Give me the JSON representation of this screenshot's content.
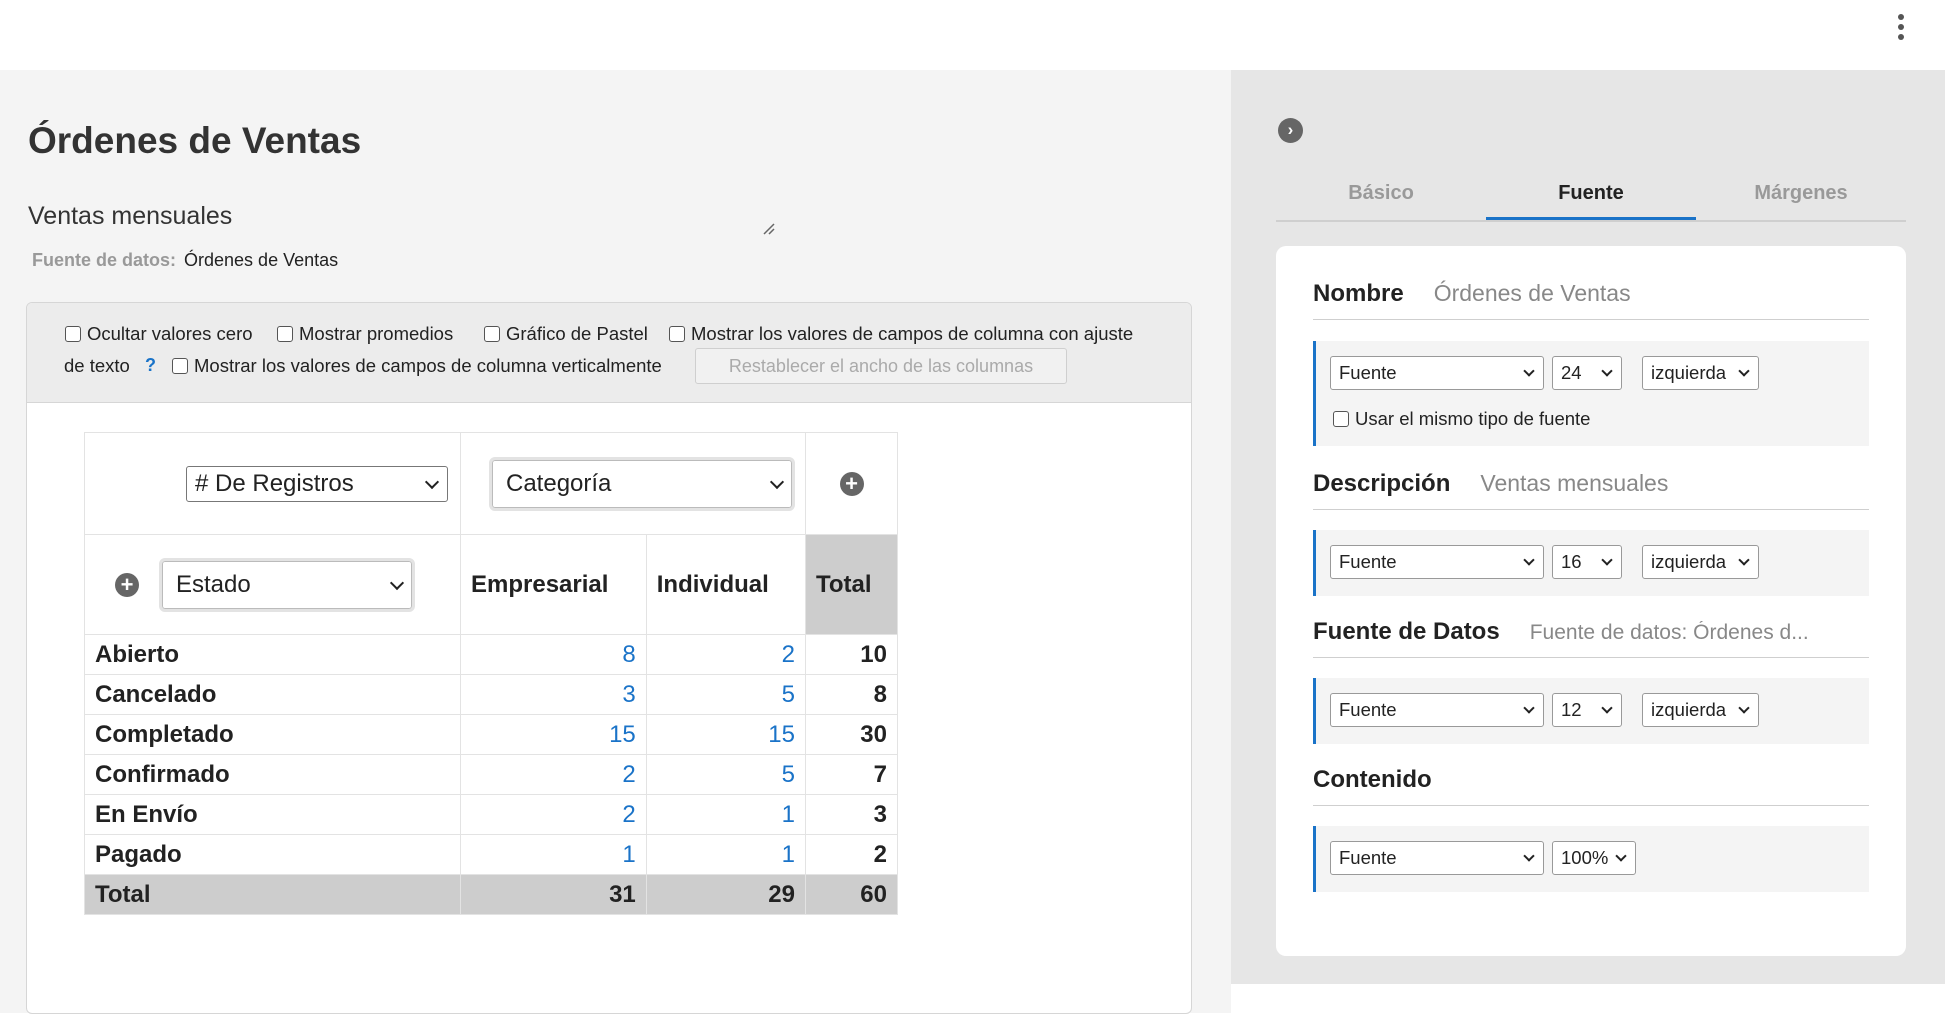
{
  "page": {
    "title": "Órdenes de Ventas",
    "description": "Ventas mensuales",
    "datasource_label": "Fuente de datos:",
    "datasource_value": "Órdenes de Ventas"
  },
  "options": {
    "hide_zero": "Ocultar valores cero",
    "show_avg": "Mostrar promedios",
    "pie": "Gráfico de Pastel",
    "wrap_part1": "Mostrar los valores de campos de columna con ajuste",
    "wrap_part2": "de texto",
    "help": "?",
    "vertical": "Mostrar los valores de campos de columna verticalmente",
    "reset": "Restablecer el ancho de las columnas"
  },
  "pivot": {
    "measure": "# De Registros",
    "column_field": "Categoría",
    "row_field": "Estado",
    "columns": [
      "Empresarial",
      "Individual",
      "Total"
    ],
    "rows": [
      {
        "label": "Abierto",
        "values": [
          "8",
          "2"
        ],
        "total": "10"
      },
      {
        "label": "Cancelado",
        "values": [
          "3",
          "5"
        ],
        "total": "8"
      },
      {
        "label": "Completado",
        "values": [
          "15",
          "15"
        ],
        "total": "30"
      },
      {
        "label": "Confirmado",
        "values": [
          "2",
          "5"
        ],
        "total": "7"
      },
      {
        "label": "En Envío",
        "values": [
          "2",
          "1"
        ],
        "total": "3"
      },
      {
        "label": "Pagado",
        "values": [
          "1",
          "1"
        ],
        "total": "2"
      }
    ],
    "total_row": {
      "label": "Total",
      "values": [
        "31",
        "29"
      ],
      "total": "60"
    }
  },
  "panel": {
    "tabs": [
      "Básico",
      "Fuente",
      "Márgenes"
    ],
    "active_tab": "Fuente",
    "sections": {
      "nombre": {
        "title": "Nombre",
        "value": "Órdenes de Ventas",
        "font": "Fuente",
        "size": "24",
        "align": "izquierda",
        "same_font": "Usar el mismo tipo de fuente"
      },
      "descripcion": {
        "title": "Descripción",
        "value": "Ventas mensuales",
        "font": "Fuente",
        "size": "16",
        "align": "izquierda"
      },
      "fuente_datos": {
        "title": "Fuente de Datos",
        "value": "Fuente de datos:  Órdenes d...",
        "font": "Fuente",
        "size": "12",
        "align": "izquierda"
      },
      "contenido": {
        "title": "Contenido",
        "font": "Fuente",
        "size": "100%"
      }
    }
  },
  "colors": {
    "accent": "#1a73c8",
    "total_bg": "#cdcdcd",
    "panel_bg": "#e6e6e6"
  }
}
